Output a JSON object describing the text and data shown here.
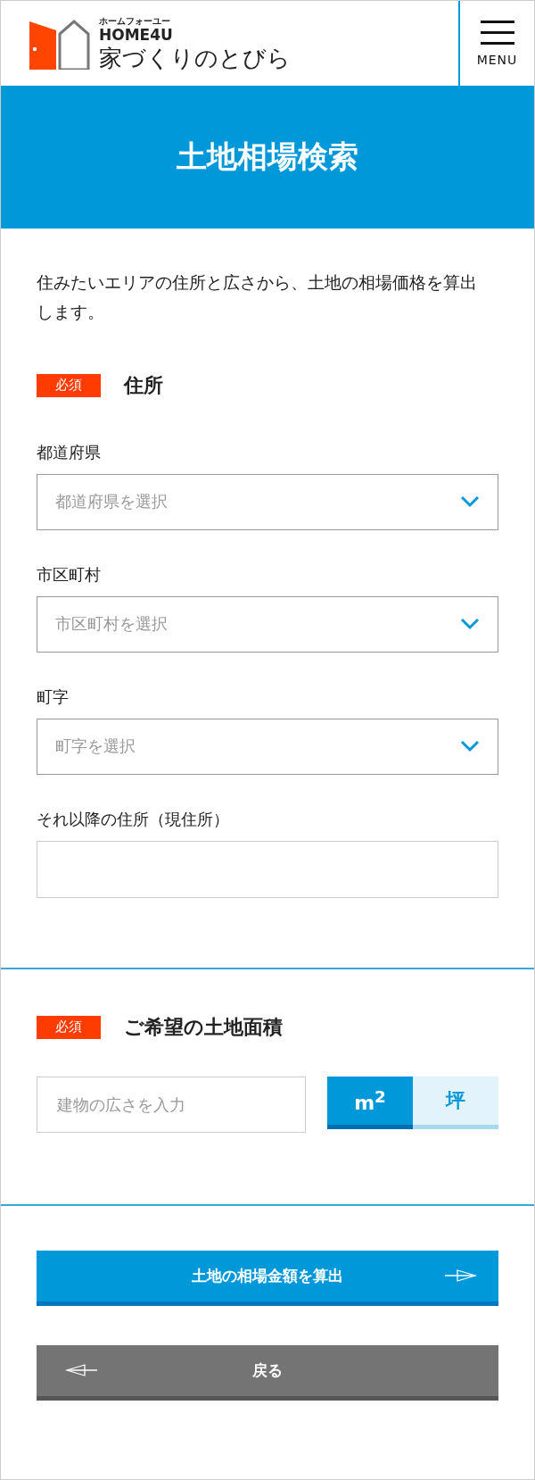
{
  "header": {
    "logo_kana": "ホームフォーユー",
    "logo_brand": "HOME4U",
    "logo_title": "家づくりのとびら",
    "menu_label": "MENU"
  },
  "page_title": "土地相場検索",
  "intro": "住みたいエリアの住所と広さから、土地の相場価格を算出します。",
  "sections": [
    {
      "required_badge": "必須",
      "title": "住所",
      "fields": [
        {
          "kind": "select",
          "label": "都道府県",
          "placeholder": "都道府県を選択"
        },
        {
          "kind": "select",
          "label": "市区町村",
          "placeholder": "市区町村を選択"
        },
        {
          "kind": "select",
          "label": "町字",
          "placeholder": "町字を選択"
        },
        {
          "kind": "text",
          "label": "それ以降の住所（現住所）"
        }
      ]
    },
    {
      "required_badge": "必須",
      "title": "ご希望の土地面積",
      "fields": [
        {
          "kind": "area",
          "placeholder": "建物の広さを入力",
          "units": [
            {
              "label": "m$^{2}$",
              "selected": true
            },
            {
              "label": "坪",
              "selected": false
            }
          ]
        }
      ]
    }
  ],
  "buttons": [
    {
      "kind": "primary",
      "label": "土地の相場金額を算出"
    },
    {
      "kind": "back",
      "label": "戻る"
    }
  ]
}
